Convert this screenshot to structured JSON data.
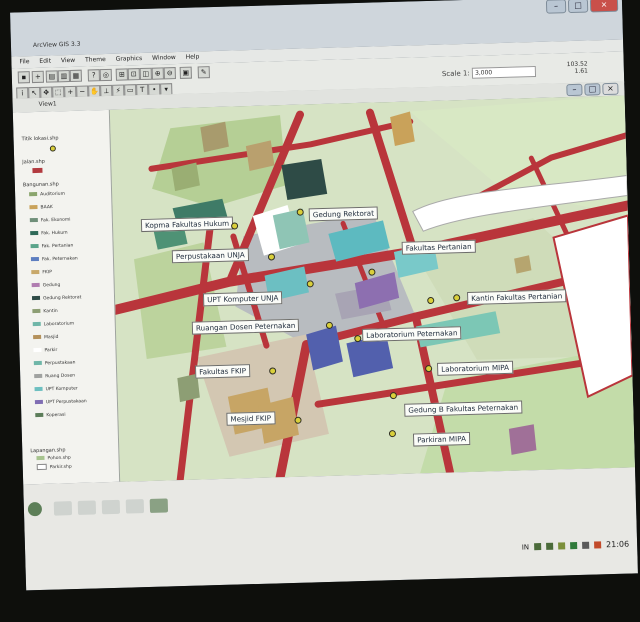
{
  "app": {
    "title": "ArcView GIS 3.3"
  },
  "window_controls": {
    "minimize": "–",
    "maximize": "□",
    "close": "×"
  },
  "menu": [
    "File",
    "Edit",
    "View",
    "Theme",
    "Graphics",
    "Window",
    "Help"
  ],
  "toolbar": {
    "scale_label": "Scale 1:",
    "scale_value": "3,000",
    "coords_top": "103.52",
    "coords_bottom": "1.61"
  },
  "view": {
    "title": "View1"
  },
  "table_of_contents": {
    "themes": [
      {
        "name": "Titik lokasi.shp"
      },
      {
        "name": "Jalan.shp"
      },
      {
        "name": "Bangunan.shp"
      }
    ],
    "legend": [
      {
        "label": "Auditorium",
        "color": "#8aa56d"
      },
      {
        "label": "BAAK",
        "color": "#c9a25a"
      },
      {
        "label": "Fak. Ekonomi",
        "color": "#6f8f79"
      },
      {
        "label": "Fak. Hukum",
        "color": "#2f6a58"
      },
      {
        "label": "Fak. Pertanian",
        "color": "#5aa48a"
      },
      {
        "label": "Fak. Peternakan",
        "color": "#5d7ec0"
      },
      {
        "label": "FKIP",
        "color": "#c8a86a"
      },
      {
        "label": "Gedung",
        "color": "#b07cb0"
      },
      {
        "label": "Gedung Rektorat",
        "color": "#2e4b46"
      },
      {
        "label": "Kantin",
        "color": "#8d9e74"
      },
      {
        "label": "Laboratorium",
        "color": "#6fb6a8"
      },
      {
        "label": "Masjid",
        "color": "#b4915b"
      },
      {
        "label": "Parkir",
        "color": "#ffffff"
      },
      {
        "label": "Perpustakaan",
        "color": "#6fb6a8"
      },
      {
        "label": "Ruang Dosen",
        "color": "#a0a2a0"
      },
      {
        "label": "UPT Komputer",
        "color": "#6dbfc0"
      },
      {
        "label": "UPT Perpustakaan",
        "color": "#7f6db3"
      },
      {
        "label": "Koperasi",
        "color": "#5c7d5a"
      }
    ],
    "extra_themes": [
      {
        "name": "Lapangan.shp"
      },
      {
        "name": "Pohon.shp"
      },
      {
        "name": "Parkir.shp"
      }
    ]
  },
  "map": {
    "labels": [
      "Gedung Rektorat",
      "Kopma Fakultas Hukum",
      "Perpustakaan UNJA",
      "Fakultas Pertanian",
      "UPT Komputer UNJA",
      "Kantin Fakultas Pertanian",
      "Ruangan Dosen Peternakan",
      "Laboratorium Peternakan",
      "Fakultas FKIP",
      "Laboratorium MIPA",
      "Gedung B Fakultas Peternakan",
      "Mesjid FKIP",
      "Parkiran MIPA"
    ]
  },
  "taskbar": {
    "clock": "21:06",
    "lang": "IN"
  }
}
